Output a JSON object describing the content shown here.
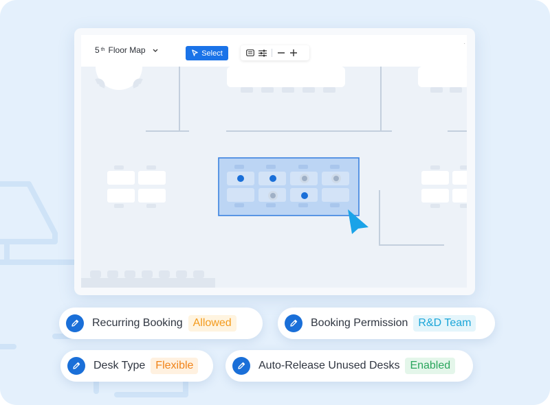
{
  "toolbar": {
    "floor_title": "5",
    "floor_title_sup": "th",
    "floor_title_rest": "Floor Map",
    "select_label": "Select",
    "icons": [
      "chevron-down-icon",
      "cursor-icon",
      "keyboard-icon",
      "sliders-icon",
      "minus-icon",
      "plus-icon"
    ]
  },
  "chips": [
    {
      "label": "Recurring Booking",
      "value": "Allowed",
      "color": "#f39a1c"
    },
    {
      "label": "Booking Permission",
      "value": "R&D Team",
      "color": "#1aa5d8"
    },
    {
      "label": "Desk Type",
      "value": "Flexible",
      "color": "#f08319"
    },
    {
      "label": "Auto-Release Unused Desks",
      "value": "Enabled",
      "color": "#2aa55c"
    }
  ],
  "colors": {
    "accent": "#1a73e8",
    "background": "#e4f0fc",
    "selection_fill": "#bcd5f4",
    "cursor": "#1aa3e8"
  }
}
